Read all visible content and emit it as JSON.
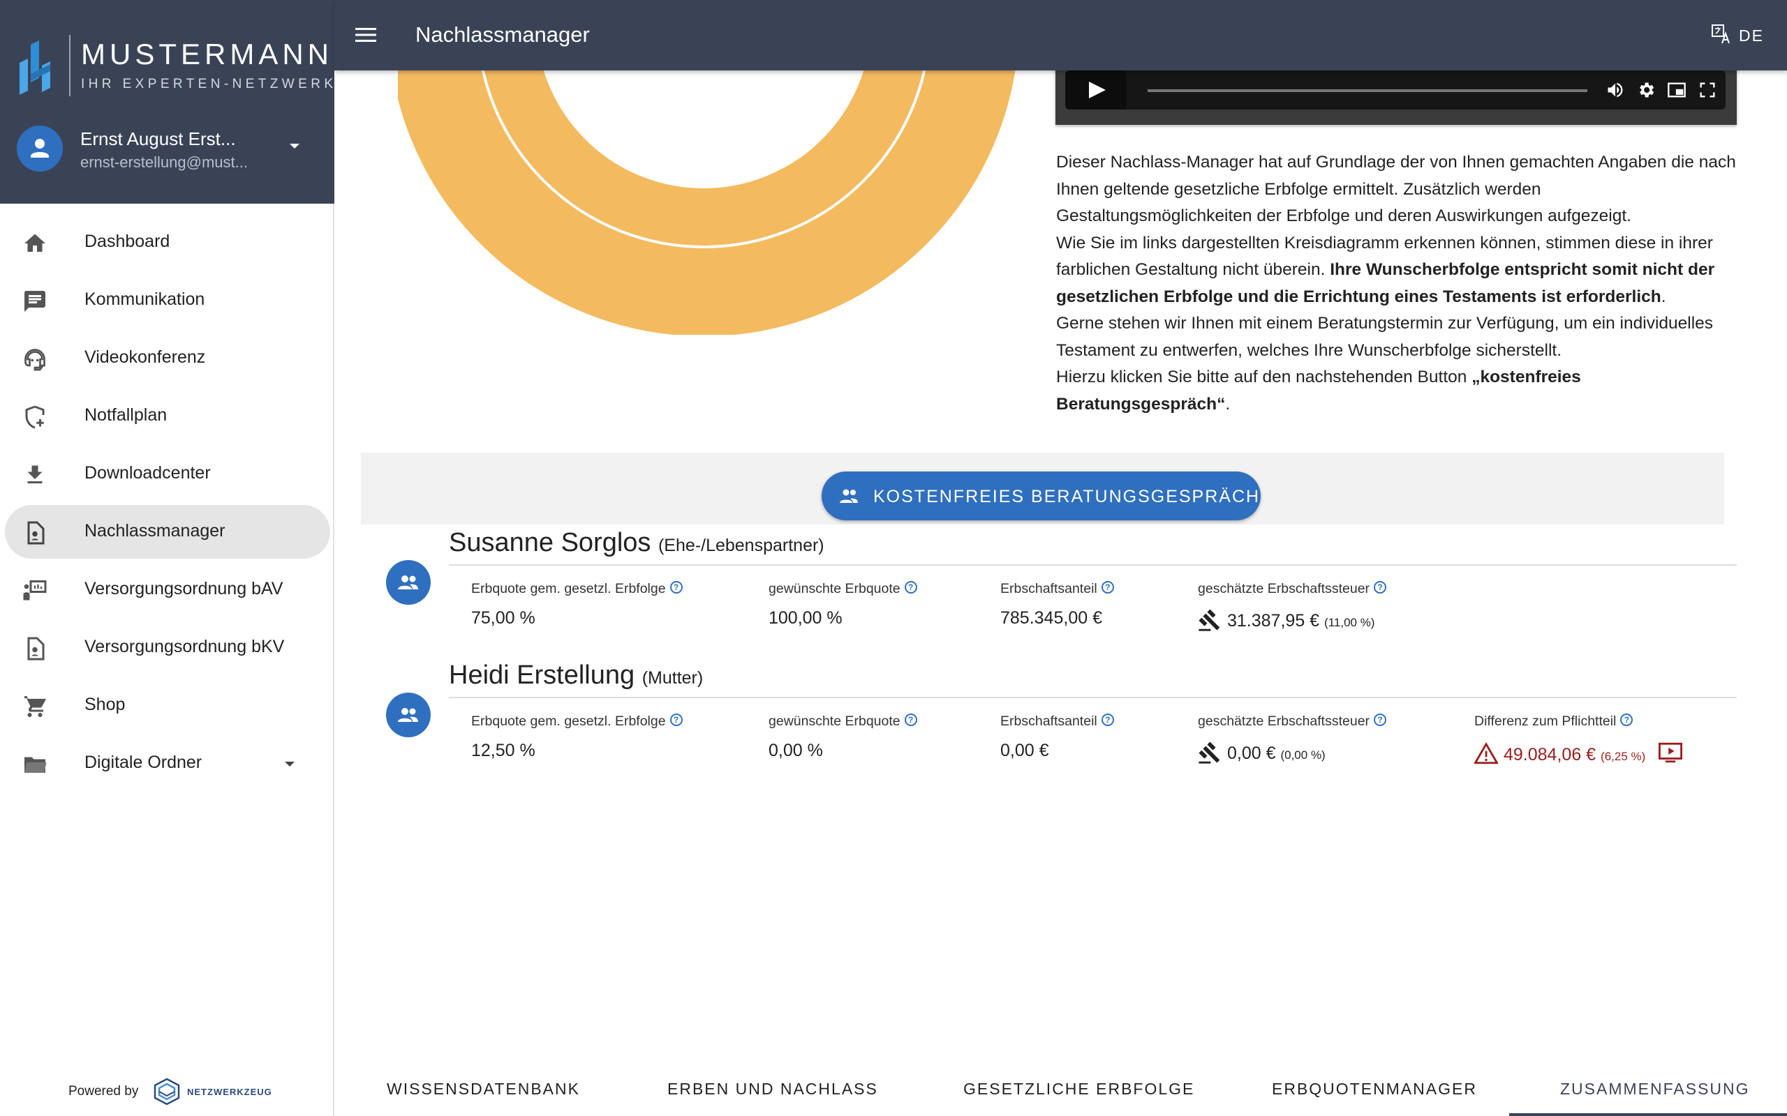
{
  "app": {
    "brand_title": "MUSTERMANN",
    "brand_subtitle": "IHR EXPERTEN-NETZWERK",
    "page_title": "Nachlassmanager",
    "language": "DE",
    "accent_color": "#2f6fbf",
    "header_color": "#3a4356"
  },
  "user": {
    "name": "Ernst August Erst...",
    "email": "ernst-erstellung@must..."
  },
  "sidebar": {
    "items": [
      {
        "label": "Dashboard",
        "icon": "home-icon"
      },
      {
        "label": "Kommunikation",
        "icon": "chat-icon"
      },
      {
        "label": "Videokonferenz",
        "icon": "headset-icon"
      },
      {
        "label": "Notfallplan",
        "icon": "shield-plus-icon"
      },
      {
        "label": "Downloadcenter",
        "icon": "download-icon"
      },
      {
        "label": "Nachlassmanager",
        "icon": "document-icon",
        "active": true
      },
      {
        "label": "Versorgungsordnung bAV",
        "icon": "presentation-icon"
      },
      {
        "label": "Versorgungsordnung bKV",
        "icon": "document-icon"
      },
      {
        "label": "Shop",
        "icon": "cart-icon"
      },
      {
        "label": "Digitale Ordner",
        "icon": "folder-icon"
      }
    ],
    "powered_by": "Powered by",
    "powered_brand": "NETZWERKZEUG"
  },
  "description": {
    "p1": "Dieser Nachlass-Manager hat auf Grundlage der von Ihnen gemachten Angaben die nach Ihnen geltende gesetzliche Erbfolge ermittelt. Zusätzlich werden Gestaltungsmöglichkeiten der Erbfolge und deren Auswirkungen aufgezeigt.",
    "p2_start": "Wie Sie im links dargestellten Kreisdiagramm erkennen können, stimmen diese in ihrer farblichen Gestaltung nicht überein. ",
    "p2_bold": "Ihre Wunscherbfolge entspricht somit nicht der gesetzlichen Erbfolge und die Errichtung eines Testaments ist erforderlich",
    "p2_end": ".",
    "p3": "Gerne stehen wir Ihnen mit einem Beratungstermin zur Verfügung, um ein individuelles Testament zu entwerfen, welches Ihre Wunscherbfolge sicherstellt.",
    "p4_start": "Hierzu klicken Sie bitte auf den nachstehenden Button ",
    "p4_bold": "„kostenfreies Beratungsgespräch“",
    "p4_end": "."
  },
  "cta": {
    "label": "KOSTENFREIES BERATUNGSGESPRÄCH"
  },
  "labels": {
    "quota_legal": "Erbquote gem. gesetzl. Erbfolge",
    "quota_wanted": "gewünschte Erbquote",
    "share": "Erbschaftsanteil",
    "tax": "geschätzte Erbschaftssteuer",
    "diff": "Differenz zum Pflichtteil"
  },
  "heirs": [
    {
      "name": "Susanne Sorglos",
      "relation": "(Ehe-/Lebenspartner)",
      "quota_legal": "75,00 %",
      "quota_wanted": "100,00 %",
      "share": "785.345,00 €",
      "tax": "31.387,95 €",
      "tax_pct": "(11,00 %)"
    },
    {
      "name": "Heidi Erstellung",
      "relation": "(Mutter)",
      "quota_legal": "12,50 %",
      "quota_wanted": "0,00 %",
      "share": "0,00 €",
      "tax": "0,00 €",
      "tax_pct": "(0,00 %)",
      "diff": "49.084,06 €",
      "diff_pct": "(6,25 %)"
    }
  ],
  "tabs": [
    {
      "label": "WISSENSDATENBANK"
    },
    {
      "label": "ERBEN UND NACHLASS"
    },
    {
      "label": "GESETZLICHE ERBFOLGE"
    },
    {
      "label": "ERBQUOTENMANAGER"
    },
    {
      "label": "ZUSAMMENFASSUNG",
      "active": true
    }
  ]
}
